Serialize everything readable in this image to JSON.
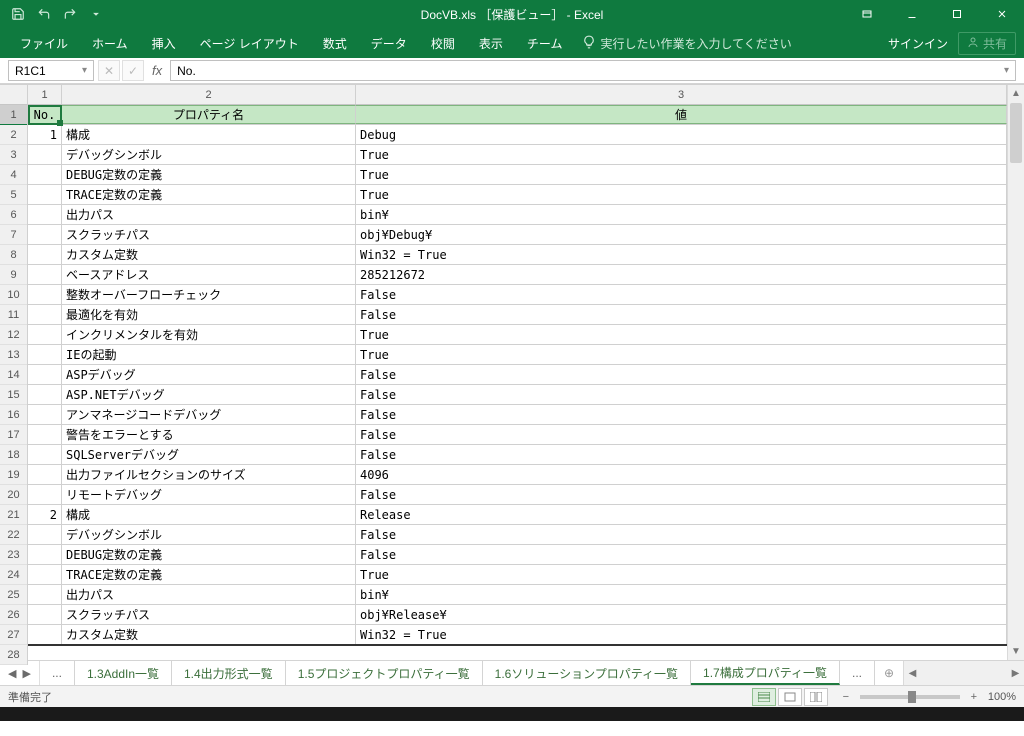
{
  "title": "DocVB.xls ［保護ビュー］ - Excel",
  "ribbon": {
    "tabs": [
      "ファイル",
      "ホーム",
      "挿入",
      "ページ レイアウト",
      "数式",
      "データ",
      "校閲",
      "表示",
      "チーム"
    ],
    "tellme": "実行したい作業を入力してください",
    "signin": "サインイン",
    "share": "共有"
  },
  "formula": {
    "namebox": "R1C1",
    "value": "No."
  },
  "columns": [
    "1",
    "2",
    "3"
  ],
  "headers": {
    "c1": "No.",
    "c2": "プロパティ名",
    "c3": "値"
  },
  "rows": [
    {
      "n": "1",
      "no": "1",
      "name": "構成",
      "val": "Debug"
    },
    {
      "n": "2",
      "no": "",
      "name": "デバッグシンボル",
      "val": "True"
    },
    {
      "n": "3",
      "no": "",
      "name": "DEBUG定数の定義",
      "val": "True"
    },
    {
      "n": "4",
      "no": "",
      "name": "TRACE定数の定義",
      "val": "True"
    },
    {
      "n": "5",
      "no": "",
      "name": "出力パス",
      "val": "bin¥"
    },
    {
      "n": "6",
      "no": "",
      "name": "スクラッチパス",
      "val": "obj¥Debug¥"
    },
    {
      "n": "7",
      "no": "",
      "name": "カスタム定数",
      "val": "Win32 = True"
    },
    {
      "n": "8",
      "no": "",
      "name": "ベースアドレス",
      "val": "285212672"
    },
    {
      "n": "9",
      "no": "",
      "name": "整数オーバーフローチェック",
      "val": "False"
    },
    {
      "n": "10",
      "no": "",
      "name": "最適化を有効",
      "val": "False"
    },
    {
      "n": "11",
      "no": "",
      "name": "インクリメンタルを有効",
      "val": "True"
    },
    {
      "n": "12",
      "no": "",
      "name": "IEの起動",
      "val": "True"
    },
    {
      "n": "13",
      "no": "",
      "name": "ASPデバッグ",
      "val": "False"
    },
    {
      "n": "14",
      "no": "",
      "name": "ASP.NETデバッグ",
      "val": "False"
    },
    {
      "n": "15",
      "no": "",
      "name": "アンマネージコードデバッグ",
      "val": "False"
    },
    {
      "n": "16",
      "no": "",
      "name": "警告をエラーとする",
      "val": "False"
    },
    {
      "n": "17",
      "no": "",
      "name": "SQLServerデバッグ",
      "val": "False"
    },
    {
      "n": "18",
      "no": "",
      "name": "出力ファイルセクションのサイズ",
      "val": "4096"
    },
    {
      "n": "19",
      "no": "",
      "name": "リモートデバッグ",
      "val": "False"
    },
    {
      "n": "20",
      "no": "2",
      "name": "構成",
      "val": "Release"
    },
    {
      "n": "21",
      "no": "",
      "name": "デバッグシンボル",
      "val": "False"
    },
    {
      "n": "22",
      "no": "",
      "name": "DEBUG定数の定義",
      "val": "False"
    },
    {
      "n": "23",
      "no": "",
      "name": "TRACE定数の定義",
      "val": "True"
    },
    {
      "n": "24",
      "no": "",
      "name": "出力パス",
      "val": "bin¥"
    },
    {
      "n": "25",
      "no": "",
      "name": "スクラッチパス",
      "val": "obj¥Release¥"
    },
    {
      "n": "26",
      "no": "",
      "name": "カスタム定数",
      "val": "Win32 = True"
    }
  ],
  "sheetTabs": {
    "prev_dots": "...",
    "tabs": [
      "1.3AddIn一覧",
      "1.4出力形式一覧",
      "1.5プロジェクトプロパティ一覧",
      "1.6ソリューションプロパティ一覧",
      "1.7構成プロパティ一覧"
    ],
    "active_index": 4,
    "next_dots": "..."
  },
  "status": {
    "ready": "準備完了",
    "zoom": "100%"
  }
}
